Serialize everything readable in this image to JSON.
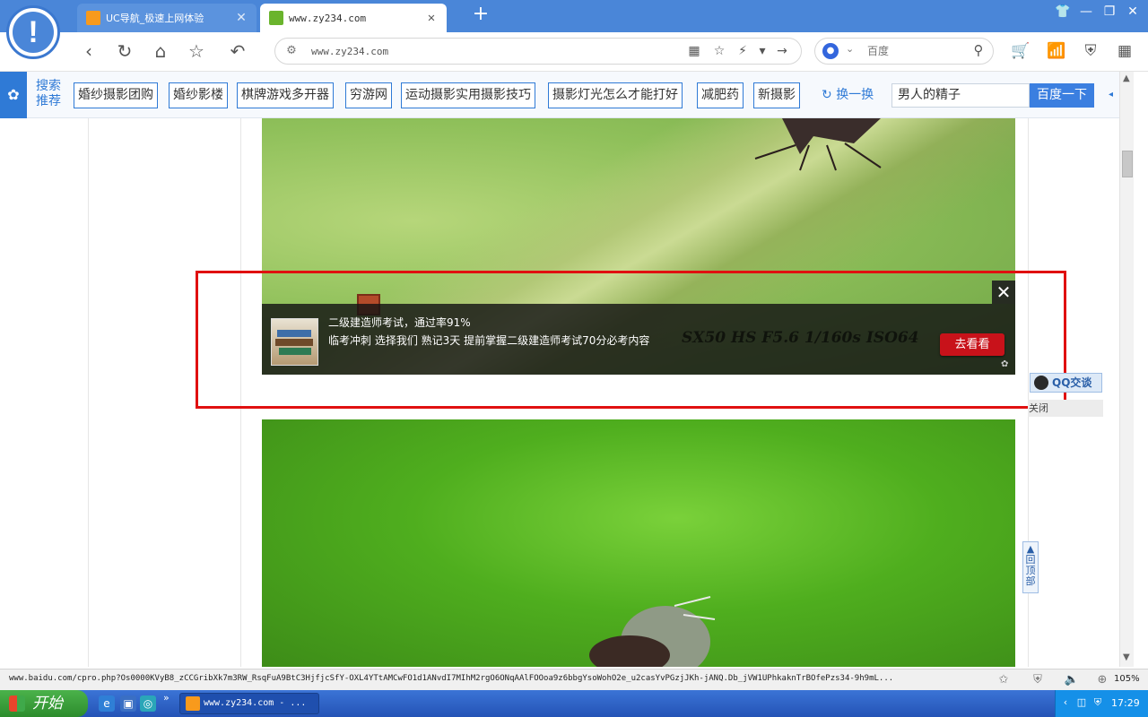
{
  "browser": {
    "tabs": [
      {
        "title": "UC导航_极速上网体验",
        "active": false
      },
      {
        "title": "www.zy234.com",
        "active": true
      }
    ],
    "address": "www.zy234.com",
    "search_engine": "百度",
    "search_placeholder": "百度"
  },
  "recommend_bar": {
    "title": "搜索推荐",
    "chips": [
      "婚纱摄影团购",
      "婚纱影楼",
      "棋牌游戏多开器",
      "穷游网",
      "运动摄影实用摄影技巧",
      "摄影灯光怎么才能打好",
      "减肥药",
      "新摄影"
    ],
    "refresh_label": "换一换",
    "search_value": "男人的精子",
    "search_button": "百度一下"
  },
  "ad": {
    "title": "二级建造师考试，通过率91%",
    "description": "临考冲刺 选择我们 熟记3天 提前掌握二级建造师考试70分必考内容",
    "watermark": "SX50 HS F5.6 1/160s ISO64",
    "cta_label": "去看看",
    "close_glyph": "✕"
  },
  "sidebar": {
    "qq_label": "QQ交谈",
    "qq_close": "关闭",
    "back_to_top": "回顶部"
  },
  "status": {
    "url": "www.baidu.com/cpro.php?Os0000KVyB8_zCCGribXk7m3RW_RsqFuA9BtC3HjfjcSfY-OXL4YTtAMCwFO1d1ANvdI7MIhM2rgO6ONqAAlFOOoa9z6bbgYsoWohO2e_u2casYvPGzjJKh-jANQ.Db_jVW1UPhkaknTrBOfePzs34-9h9mL...",
    "zoom": "105%"
  },
  "taskbar": {
    "start_label": "开始",
    "task_title": "www.zy234.com - ...",
    "clock": "17:29"
  },
  "colors": {
    "accent": "#4a86d8",
    "link": "#2f7ad6",
    "highlight": "#e01010",
    "cta": "#c8121a"
  }
}
